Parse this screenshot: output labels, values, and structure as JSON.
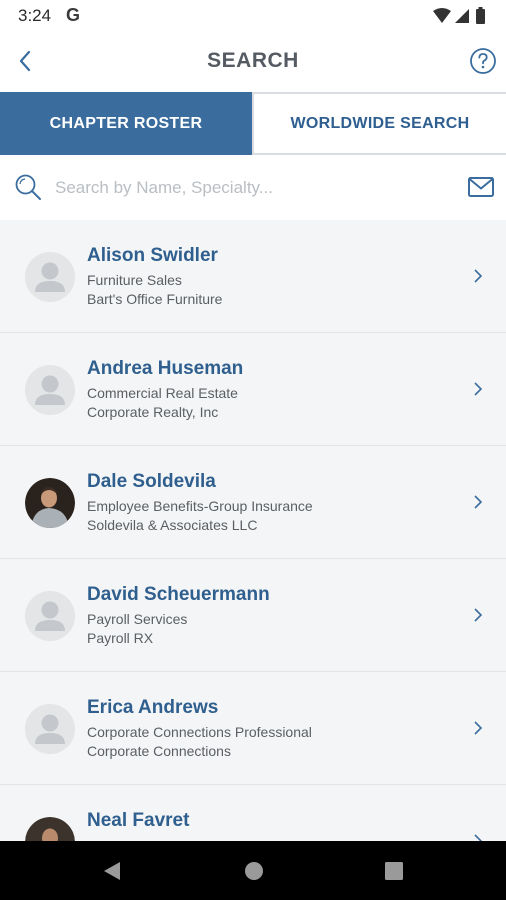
{
  "status_bar": {
    "time": "3:24",
    "g_label": "G"
  },
  "header": {
    "title": "SEARCH"
  },
  "tabs": [
    {
      "label": "CHAPTER ROSTER",
      "active": true
    },
    {
      "label": "WORLDWIDE SEARCH",
      "active": false
    }
  ],
  "search": {
    "placeholder": "Search by Name, Specialty...",
    "value": ""
  },
  "members": [
    {
      "name": "Alison Swidler",
      "line1": "Furniture Sales",
      "line2": "Bart's Office Furniture",
      "avatar": "placeholder"
    },
    {
      "name": "Andrea Huseman",
      "line1": "Commercial Real Estate",
      "line2": "Corporate Realty, Inc",
      "avatar": "placeholder"
    },
    {
      "name": "Dale Soldevila",
      "line1": "Employee Benefits-Group Insurance",
      "line2": "Soldevila & Associates LLC",
      "avatar": "photo"
    },
    {
      "name": "David Scheuermann",
      "line1": "Payroll Services",
      "line2": "Payroll RX",
      "avatar": "placeholder"
    },
    {
      "name": "Erica Andrews",
      "line1": "Corporate Connections Professional",
      "line2": "Corporate Connections",
      "avatar": "placeholder"
    },
    {
      "name": "Neal Favret",
      "line1": "",
      "line2": "",
      "avatar": "photo"
    }
  ],
  "colors": {
    "primary": "#3a6d9e",
    "link": "#2f5f8e",
    "list_bg": "#f4f5f6"
  },
  "icons": {
    "back": "chevron-left-icon",
    "help": "help-circle-icon",
    "search": "search-icon",
    "mail": "mail-icon",
    "row": "chevron-right-icon"
  }
}
